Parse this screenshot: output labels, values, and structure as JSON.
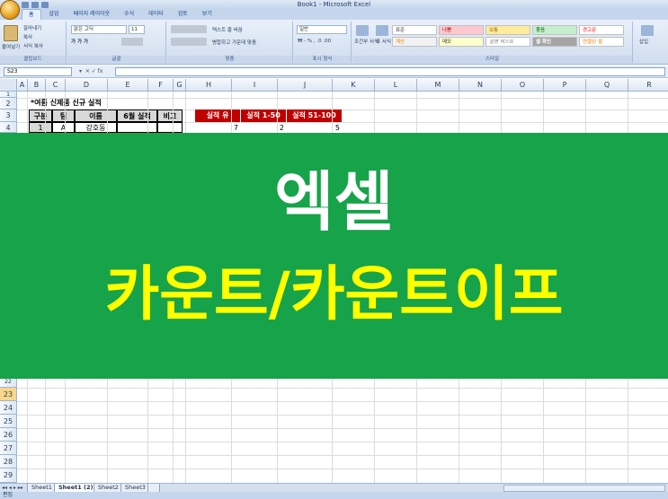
{
  "window": {
    "title": "Book1 - Microsoft Excel"
  },
  "ribbon": {
    "tabs": [
      "홈",
      "삽입",
      "페이지 레이아웃",
      "수식",
      "데이터",
      "검토",
      "보기"
    ],
    "clipboard": {
      "paste": "붙여넣기",
      "cut": "잘라내기",
      "copy": "복사",
      "format_painter": "서식 복사",
      "label": "클립보드"
    },
    "font": {
      "name": "맑은 고딕",
      "size": "11",
      "label": "글꼴"
    },
    "alignment": {
      "wrap": "텍스트 줄 바꿈",
      "merge": "병합하고 가운데 맞춤",
      "label": "맞춤"
    },
    "number": {
      "format": "일반",
      "label": "표시 형식"
    },
    "styles": {
      "conditional": "조건부 서식",
      "table": "표 서식",
      "cells": [
        {
          "label": "표준"
        },
        {
          "label": "나쁨"
        },
        {
          "label": "보통"
        },
        {
          "label": "좋음"
        },
        {
          "label": "경고문"
        },
        {
          "label": "계산"
        },
        {
          "label": "메모"
        },
        {
          "label": "설명 텍스트"
        },
        {
          "label": "셀 확인"
        },
        {
          "label": "연결된 셀"
        }
      ],
      "label": "스타일"
    },
    "cells_group": {
      "insert": "삽입"
    }
  },
  "formula_bar": {
    "name_box": "S23",
    "fx": "fx",
    "value": ""
  },
  "grid": {
    "columns": [
      "A",
      "B",
      "C",
      "D",
      "E",
      "F",
      "G",
      "H",
      "I",
      "J",
      "K",
      "L",
      "M",
      "N",
      "O",
      "P",
      "Q",
      "R"
    ],
    "rows_top": [
      "1",
      "2",
      "3",
      "4"
    ],
    "rows_bottom": [
      "22",
      "23",
      "24",
      "25",
      "26",
      "27",
      "28",
      "29"
    ],
    "selected_row": "23"
  },
  "sheet": {
    "title_cell": "*여름 신제품 신규 실적",
    "table_headers": [
      "구분",
      "팀",
      "이름",
      "6월 실적",
      "비고"
    ],
    "table_row1": [
      "1",
      "A",
      "강호동",
      "",
      ""
    ],
    "count_headers": [
      "실적 유",
      "실적 1-50",
      "실적 51-100"
    ],
    "count_values": [
      "7",
      "2",
      "5"
    ]
  },
  "banner": {
    "line1": "엑셀",
    "line2": "카운트/카운트이프",
    "bg_color": "#17a34a",
    "line1_color": "#ffffff",
    "line2_color": "#ffff00"
  },
  "sheet_tabs": [
    "Sheet1",
    "Sheet1 (2)",
    "Sheet2",
    "Sheet3"
  ],
  "status": {
    "mode": "편집"
  }
}
